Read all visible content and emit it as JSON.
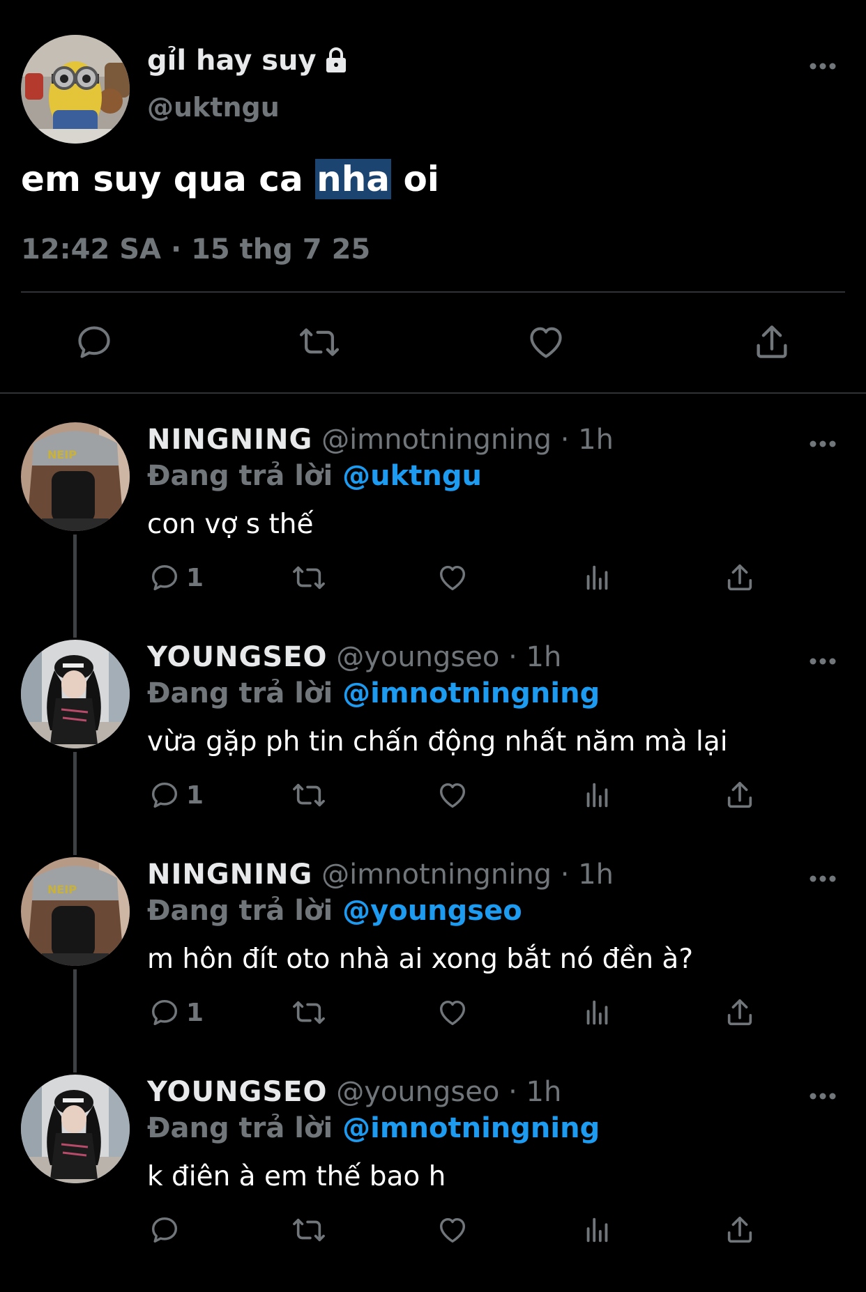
{
  "main_tweet": {
    "display_name": "gỉl hay suy",
    "handle": "@uktngu",
    "text_before": "em suy qua ca ",
    "text_highlight": "nha",
    "text_after": " oi",
    "timestamp": "12:42 SA · 15 thg 7 25",
    "icons": [
      "more-icon",
      "reply-icon",
      "retweet-icon",
      "like-icon",
      "share-icon"
    ]
  },
  "replies": [
    {
      "name": "NINGNING",
      "handle": "@imnotningning",
      "time": "· 1h",
      "replying_prefix": "Đang trả lời ",
      "replying_to": "@uktngu",
      "text": "con vợ s thế",
      "reply_count": "1"
    },
    {
      "name": "YOUNGSEO",
      "handle": "@youngseo",
      "time": "· 1h",
      "replying_prefix": "Đang trả lời ",
      "replying_to": "@imnotningning",
      "text": "vừa gặp ph tin chấn động nhất năm mà lại",
      "reply_count": "1"
    },
    {
      "name": "NINGNING",
      "handle": "@imnotningning",
      "time": "· 1h",
      "replying_prefix": "Đang trả lời ",
      "replying_to": "@youngseo",
      "text": "m hôn đít oto nhà ai xong bắt nó đền à?",
      "reply_count": "1"
    },
    {
      "name": "YOUNGSEO",
      "handle": "@youngseo",
      "time": "· 1h",
      "replying_prefix": "Đang trả lời ",
      "replying_to": "@imnotningning",
      "text": "k điên à em thế bao h",
      "reply_count": ""
    }
  ],
  "colors": {
    "background": "#000000",
    "text_primary": "#e7e9ea",
    "text_secondary": "#71767b",
    "link": "#1d9bf0",
    "divider": "#2f3336",
    "highlight": "#1c4470"
  }
}
